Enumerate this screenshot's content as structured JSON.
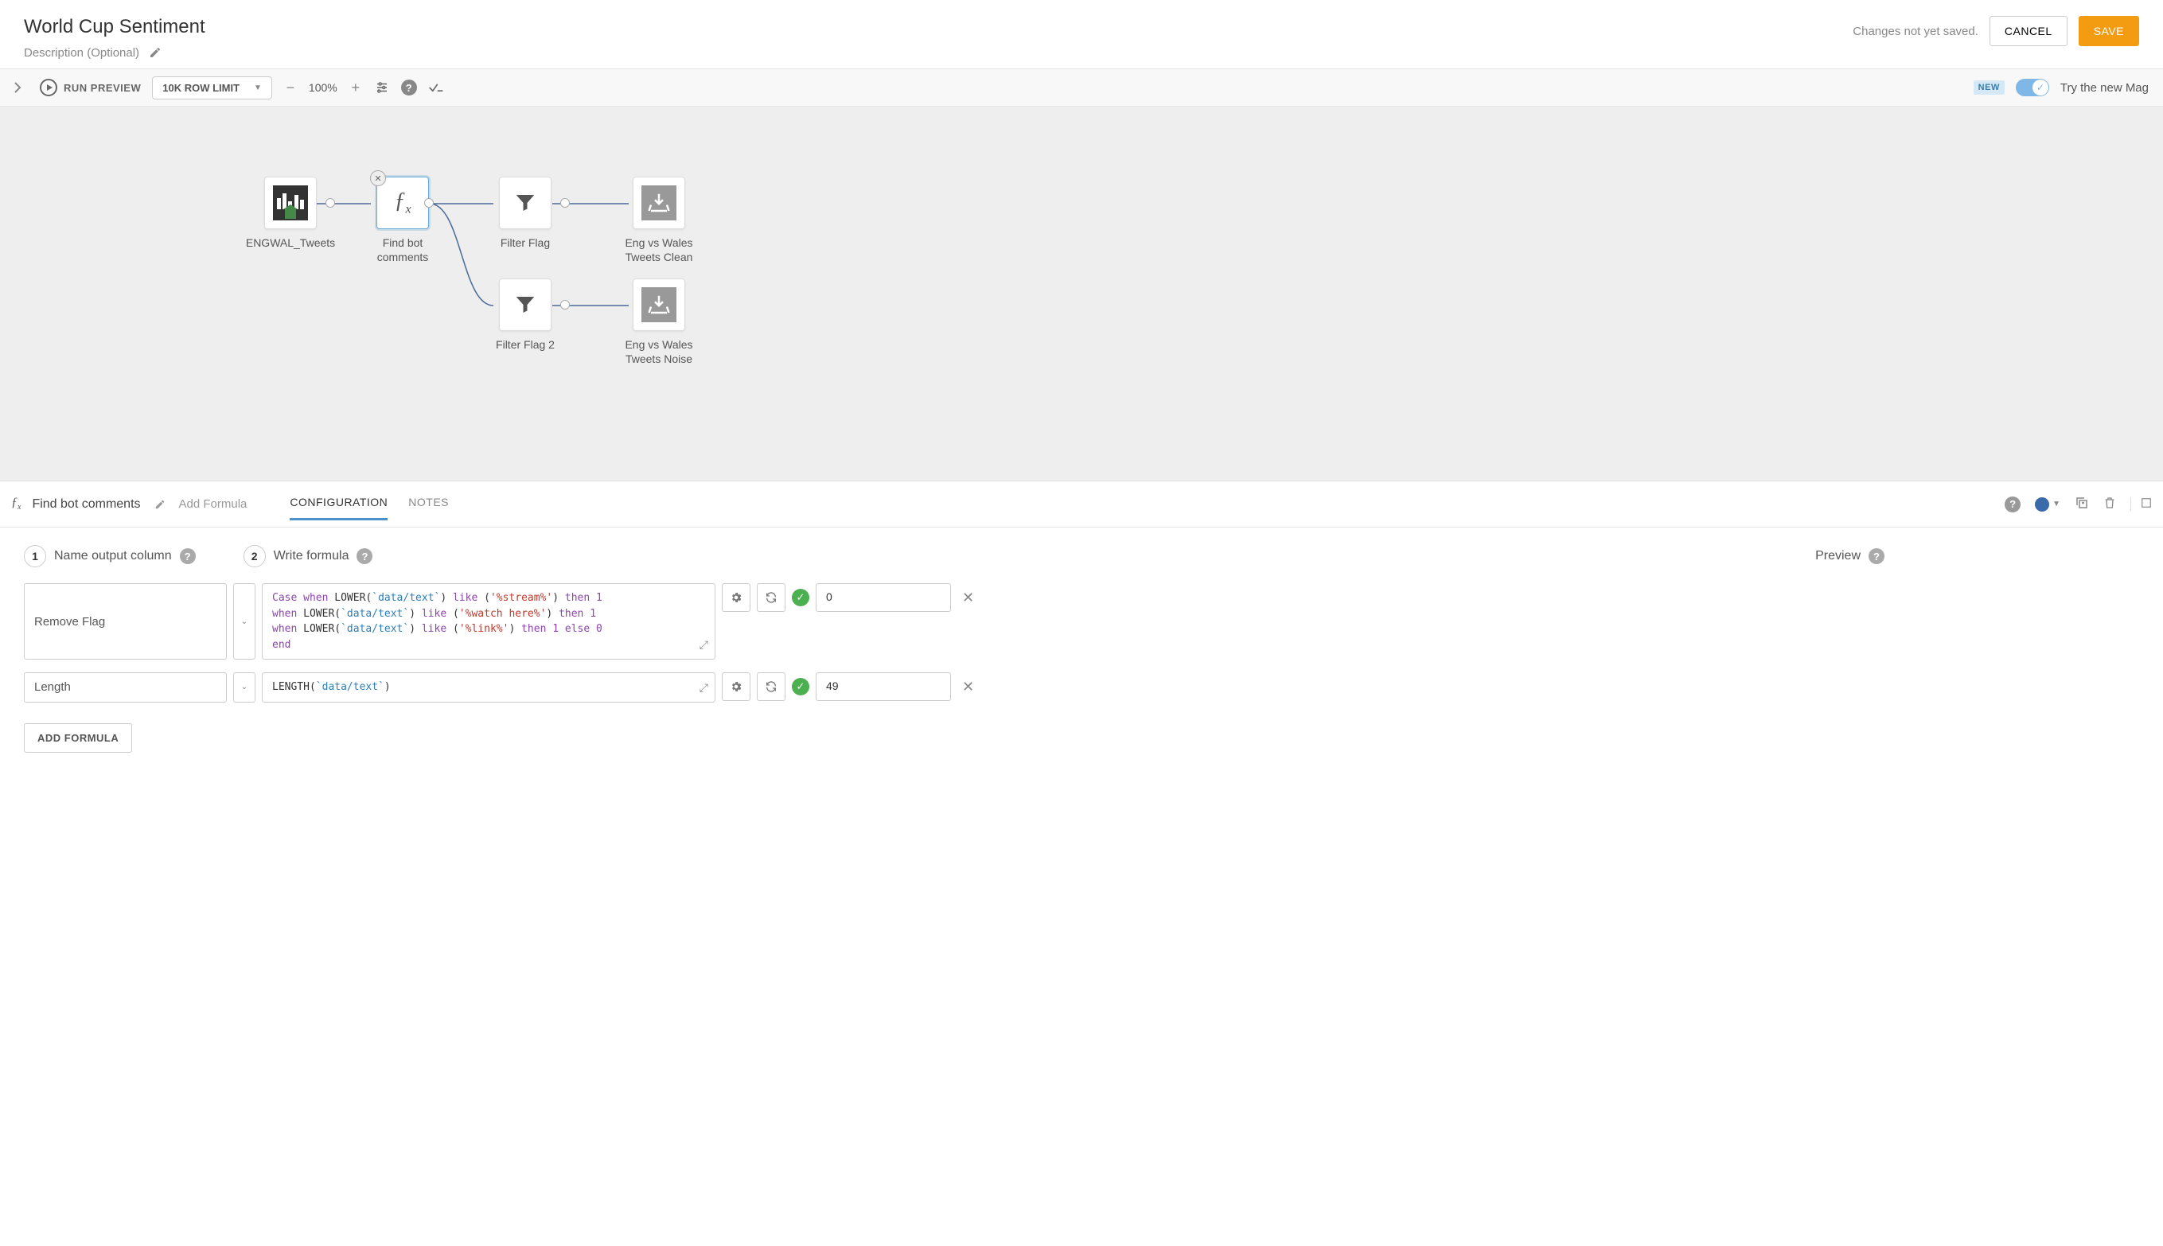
{
  "header": {
    "title": "World Cup Sentiment",
    "description_placeholder": "Description (Optional)",
    "save_status": "Changes not yet saved.",
    "cancel_label": "CANCEL",
    "save_label": "SAVE"
  },
  "toolbar": {
    "run_preview_label": "RUN PREVIEW",
    "row_limit_label": "10K ROW LIMIT",
    "zoom_level": "100%",
    "new_badge": "NEW",
    "try_new_label": "Try the new Mag"
  },
  "canvas": {
    "nodes": {
      "source": {
        "label": "ENGWAL_Tweets"
      },
      "find_bot": {
        "label": "Find bot comments"
      },
      "filter1": {
        "label": "Filter Flag"
      },
      "filter2": {
        "label": "Filter Flag 2"
      },
      "out_clean": {
        "label": "Eng vs Wales Tweets Clean"
      },
      "out_noise": {
        "label": "Eng vs Wales Tweets Noise"
      }
    }
  },
  "panel": {
    "title": "Find bot comments",
    "add_formula_link": "Add Formula",
    "tabs": {
      "configuration": "CONFIGURATION",
      "notes": "NOTES"
    },
    "step1_label": "Name output column",
    "step2_label": "Write formula",
    "preview_label": "Preview",
    "add_formula_button": "ADD FORMULA"
  },
  "formulas": [
    {
      "column_name": "Remove Flag",
      "preview_value": "0",
      "code_tokens": [
        {
          "t": "Case",
          "c": "kw"
        },
        {
          "t": " "
        },
        {
          "t": "when",
          "c": "kw"
        },
        {
          "t": " "
        },
        {
          "t": "LOWER",
          "c": "func"
        },
        {
          "t": "("
        },
        {
          "t": "`data/text`",
          "c": "field"
        },
        {
          "t": ") "
        },
        {
          "t": "like",
          "c": "kw"
        },
        {
          "t": " ("
        },
        {
          "t": "'%stream%'",
          "c": "str"
        },
        {
          "t": ") "
        },
        {
          "t": "then",
          "c": "kw"
        },
        {
          "t": " "
        },
        {
          "t": "1",
          "c": "num"
        },
        {
          "t": "\n"
        },
        {
          "t": "when",
          "c": "kw"
        },
        {
          "t": " "
        },
        {
          "t": "LOWER",
          "c": "func"
        },
        {
          "t": "("
        },
        {
          "t": "`data/text`",
          "c": "field"
        },
        {
          "t": ") "
        },
        {
          "t": "like",
          "c": "kw"
        },
        {
          "t": " ("
        },
        {
          "t": "'%watch here%'",
          "c": "str"
        },
        {
          "t": ") "
        },
        {
          "t": "then",
          "c": "kw"
        },
        {
          "t": " "
        },
        {
          "t": "1",
          "c": "num"
        },
        {
          "t": "\n"
        },
        {
          "t": "when",
          "c": "kw"
        },
        {
          "t": " "
        },
        {
          "t": "LOWER",
          "c": "func"
        },
        {
          "t": "("
        },
        {
          "t": "`data/text`",
          "c": "field"
        },
        {
          "t": ") "
        },
        {
          "t": "like",
          "c": "kw"
        },
        {
          "t": " ("
        },
        {
          "t": "'%link%'",
          "c": "str"
        },
        {
          "t": ") "
        },
        {
          "t": "then",
          "c": "kw"
        },
        {
          "t": " "
        },
        {
          "t": "1",
          "c": "num"
        },
        {
          "t": " "
        },
        {
          "t": "else",
          "c": "kw"
        },
        {
          "t": " "
        },
        {
          "t": "0",
          "c": "num"
        },
        {
          "t": "\n"
        },
        {
          "t": "end",
          "c": "kw"
        }
      ]
    },
    {
      "column_name": "Length",
      "preview_value": "49",
      "code_tokens": [
        {
          "t": "LENGTH",
          "c": "func"
        },
        {
          "t": "("
        },
        {
          "t": "`data/text`",
          "c": "field"
        },
        {
          "t": ")"
        }
      ]
    }
  ]
}
